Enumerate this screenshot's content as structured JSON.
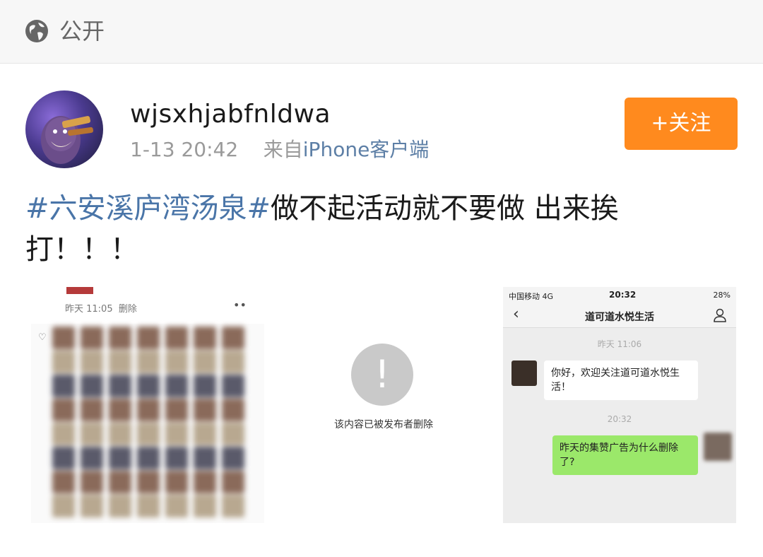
{
  "header": {
    "visibility_label": "公开",
    "icon": "globe-icon"
  },
  "post": {
    "username": "wjsxhjabfnldwa",
    "timestamp": "1-13 20:42",
    "source_prefix": "来自",
    "source": "iPhone客户端",
    "follow_label": "+关注",
    "topic": "#六安溪庐湾汤泉#",
    "body": "做不起活动就不要做  出来挨打！！！"
  },
  "image1": {
    "time_text": "昨天 11:05",
    "delete_text": "删除",
    "more_text": "••"
  },
  "image2": {
    "notice_text": "该内容已被发布者删除",
    "icon": "exclamation-icon"
  },
  "image3": {
    "carrier": "中国移动  4G",
    "clock": "20:32",
    "battery": "28%",
    "chat_title": "道可道水悦生活",
    "time1": "昨天 11:06",
    "message1": "你好，欢迎关注道可道水悦生活！",
    "time2": "20:32",
    "message2": "昨天的集赞广告为什么删除了?"
  },
  "colors": {
    "accent": "#ff8a1e",
    "topic": "#4a75a8",
    "source": "#5d7fa6",
    "chat_green": "#9be86a"
  }
}
